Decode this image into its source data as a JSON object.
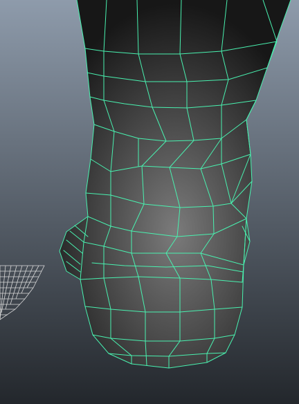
{
  "viewport": {
    "background_top": "#8e9bab",
    "background_bottom": "#23272c",
    "grid_color": "#d9d9d9",
    "wireframe_color": "#49f2b0",
    "shading_light": "#7b7b7b",
    "shading_dark": "#171717"
  }
}
